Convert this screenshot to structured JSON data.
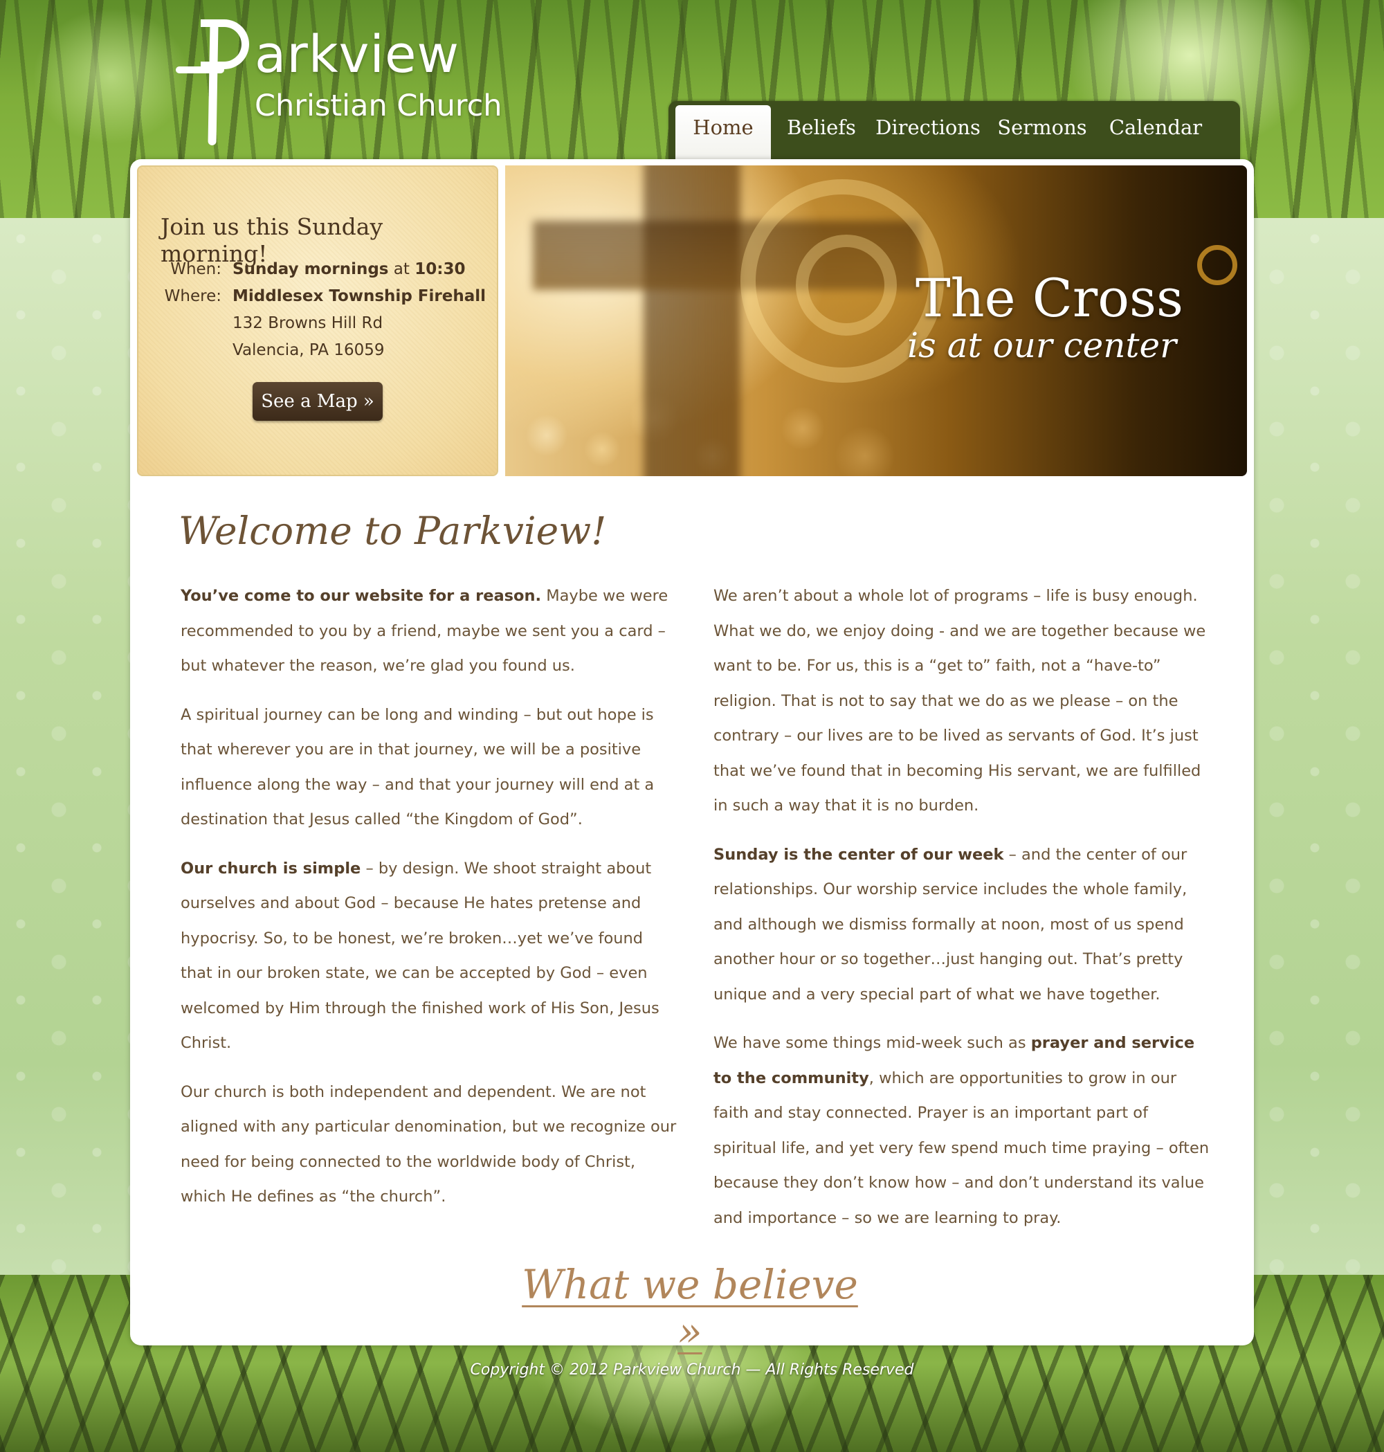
{
  "logo": {
    "name": "arkview",
    "subtitle": "Christian Church"
  },
  "nav": {
    "items": [
      {
        "label": "Home",
        "active": true
      },
      {
        "label": "Beliefs",
        "active": false
      },
      {
        "label": "Directions",
        "active": false
      },
      {
        "label": "Sermons",
        "active": false
      },
      {
        "label": "Calendar",
        "active": false
      }
    ]
  },
  "info": {
    "title": "Join us this Sunday morning!",
    "when_label": "When:",
    "when_value_1": "Sunday mornings",
    "when_value_2": " at ",
    "when_value_3": "10:30",
    "where_label": "Where:",
    "where_value": "Middlesex Township Firehall",
    "address_line1": "132 Browns Hill Rd",
    "address_line2": "Valencia, PA 16059",
    "map_button": "See a Map »"
  },
  "hero": {
    "title": "The Cross",
    "subtitle": "is at our center"
  },
  "main": {
    "heading": "Welcome to Parkview!",
    "left": {
      "p1_bold": "You’ve come to our website for a reason.",
      "p1_rest": "  Maybe we were recommended to you by a friend, maybe we sent you a card – but whatever the reason, we’re glad you found us.",
      "p2": "A spiritual journey can be long and winding – but out hope is that wherever you are in that journey, we will be a positive influence along the way – and that your journey will end at a destination that Jesus called “the Kingdom of God”.",
      "p3_bold": "Our church is simple",
      "p3_rest": " – by design.  We shoot straight about ourselves and about God – because He hates pretense and hypocrisy.  So, to be honest, we’re broken…yet we’ve found that in our broken state, we can be accepted by God – even welcomed by Him through the finished work of His Son, Jesus Christ.",
      "p4": "Our church is both independent and dependent.  We are not aligned with any particular denomination, but we recognize our need for being connected to the worldwide body of Christ, which He defines as “the church”."
    },
    "right": {
      "p1": "We aren’t about a whole lot of programs – life is busy enough.  What we do, we enjoy doing - and we are together because we want to be.  For us, this is a “get to” faith, not a “have-to” religion.  That is not to say that we do as we please – on the contrary – our lives are to be lived as servants of God.  It’s just that we’ve found that in becoming His servant, we are fulfilled in such a way that it is no burden.",
      "p2_bold": "Sunday is the center of our week",
      "p2_rest": " – and the center of our relationships.  Our worship service includes the whole family, and although we dismiss formally at noon, most of us spend another hour or so together…just hanging out.  That’s pretty unique and a very special part of what we have together.",
      "p3_pre": "We have some things mid-week such as ",
      "p3_bold": "prayer and service to the community",
      "p3_rest": ", which are opportunities to grow in our faith and stay connected.  Prayer is an important part of spiritual life, and yet very few spend much time praying – often because they don’t know how – and don’t understand its value and importance – so we are learning to pray."
    },
    "believe_link": "What we believe »"
  },
  "footer": {
    "copyright": "Copyright © 2012 Parkview Church — All Rights Reserved"
  },
  "colors": {
    "nav_bg": "#3d4e1c",
    "brown_text": "#6b5438",
    "link": "#b1865b",
    "button": "#4a3622"
  }
}
